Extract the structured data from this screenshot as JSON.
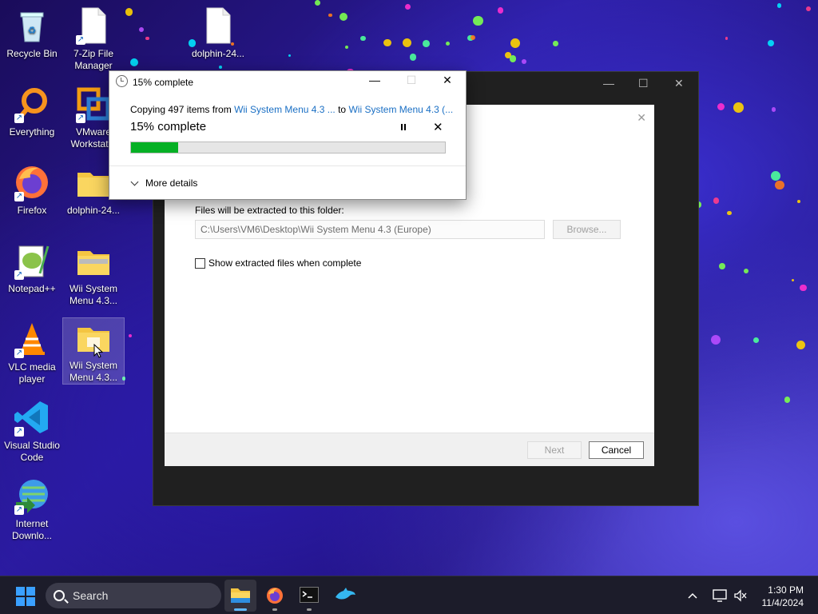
{
  "desktop": {
    "icons": [
      {
        "label": "Recycle Bin"
      },
      {
        "label": "7-Zip File Manager"
      },
      {
        "label": "dolphin-24..."
      },
      {
        "label": "Everything"
      },
      {
        "label": "VMware Workstat..."
      },
      {
        "label": "Firefox"
      },
      {
        "label": "dolphin-24..."
      },
      {
        "label": "Notepad++"
      },
      {
        "label": "Wii System Menu 4.3..."
      },
      {
        "label": "VLC media player"
      },
      {
        "label": "Wii System Menu 4.3..."
      },
      {
        "label": "Visual Studio Code"
      },
      {
        "label": "Internet Downlo..."
      }
    ]
  },
  "installer": {
    "extract_label": "Files will be extracted to this folder:",
    "path_value": "C:\\Users\\VM6\\Desktop\\Wii System Menu 4.3 (Europe)",
    "browse_label": "Browse...",
    "show_files_label": "Show extracted files when complete",
    "next_label": "Next",
    "cancel_label": "Cancel"
  },
  "copy_dialog": {
    "title": "15% complete",
    "copying_prefix": "Copying 497 items from ",
    "source": "Wii System Menu 4.3 ...",
    "to_word": " to ",
    "destination": "Wii System Menu 4.3 (...",
    "status": "15% complete",
    "progress": 0.15,
    "more_details_label": "More details",
    "accent_color": "#06b025"
  },
  "taskbar": {
    "search_label": "Search",
    "time": "1:30 PM",
    "date": "11/4/2024",
    "apps": [
      "file-explorer-icon",
      "firefox-icon",
      "terminal-icon",
      "dolphin-icon"
    ]
  }
}
